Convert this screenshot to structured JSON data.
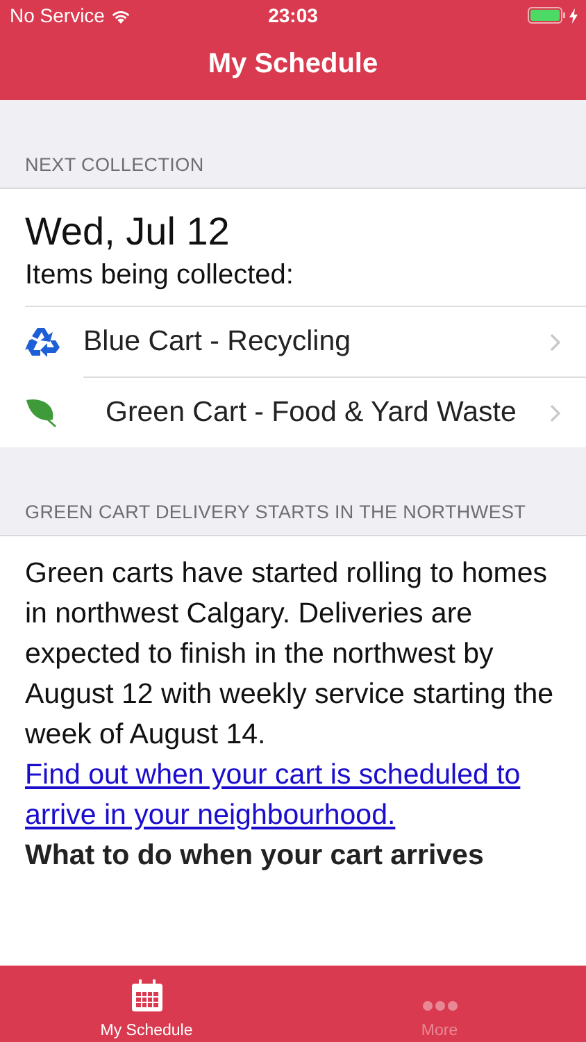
{
  "status_bar": {
    "carrier": "No Service",
    "time": "23:03",
    "charging": true
  },
  "nav": {
    "title": "My Schedule"
  },
  "next_collection": {
    "heading": "NEXT COLLECTION",
    "date": "Wed, Jul 12",
    "subtitle": "Items being collected:",
    "items": [
      {
        "label": "Blue Cart - Recycling",
        "kind": "recycling"
      },
      {
        "label": "Green Cart - Food & Yard Waste",
        "kind": "leaf"
      }
    ]
  },
  "news": {
    "heading": "GREEN CART DELIVERY STARTS IN THE NORTHWEST",
    "body": "Green carts have started rolling to homes in northwest Calgary. Deliveries are expected to finish in the northwest by August 12 with weekly service starting the week of August 14.",
    "link": "Find out when your cart is scheduled to arrive in your neighbourhood.",
    "subheading": "What to do when your cart arrives"
  },
  "tabs": [
    {
      "label": "My Schedule",
      "kind": "calendar",
      "selected": true
    },
    {
      "label": "More",
      "kind": "more",
      "selected": false
    }
  ]
}
